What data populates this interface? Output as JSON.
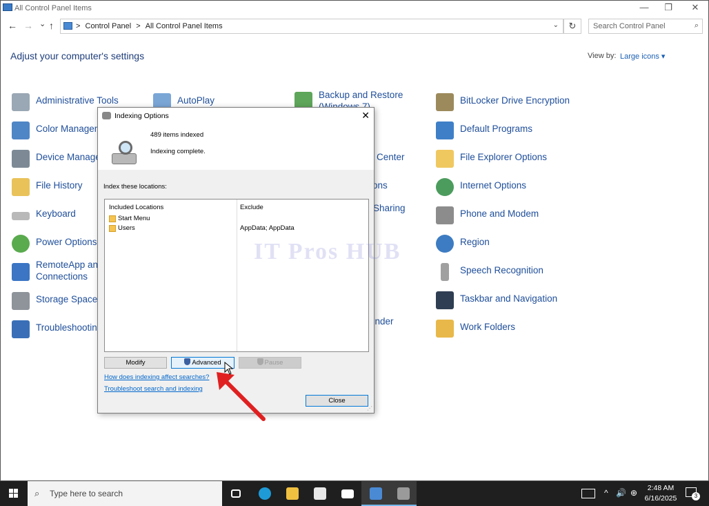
{
  "window": {
    "title": "All Control Panel Items",
    "minimize": "—",
    "maximize": "❐",
    "close": "✕"
  },
  "address": {
    "back": "←",
    "forward": "→",
    "recent": "⌄",
    "up": "↑",
    "sep": ">",
    "crumb1": "Control Panel",
    "crumb2": "All Control Panel Items",
    "refresh": "↻",
    "search_placeholder": "Search Control Panel",
    "search_icon": "⌕"
  },
  "main": {
    "heading": "Adjust your computer's settings",
    "view_by_label": "View by:",
    "view_by_value": "Large icons ▾"
  },
  "items": {
    "admin_tools": "Administrative Tools",
    "color_mgmt": "Color Managem",
    "device_mgr": "Device Manager",
    "file_history": "File History",
    "keyboard": "Keyboard",
    "power": "Power Options",
    "remoteapp_1": "RemoteApp and",
    "remoteapp_2": "Connections",
    "storage": "Storage Spaces",
    "troubleshoot": "Troubleshooting",
    "autoplay": "AutoPlay",
    "backup_1": "Backup and Restore",
    "backup_2": "(Windows 7)",
    "center": "Center",
    "ons": "ons",
    "sharing": "Sharing",
    "ender": "ender",
    "bitlocker": "BitLocker Drive Encryption",
    "default_programs": "Default Programs",
    "file_explorer": "File Explorer Options",
    "internet": "Internet Options",
    "phone_modem": "Phone and Modem",
    "region": "Region",
    "speech": "Speech Recognition",
    "taskbar_nav": "Taskbar and Navigation",
    "work_folders": "Work Folders"
  },
  "dialog": {
    "title": "Indexing Options",
    "close": "✕",
    "items_indexed": "489 items indexed",
    "status": "Indexing complete.",
    "index_label": "Index these locations:",
    "col_included": "Included Locations",
    "col_exclude": "Exclude",
    "locations": [
      "Start Menu",
      "Users"
    ],
    "exclude_users": "AppData; AppData",
    "modify": "Modify",
    "advanced": "Advanced",
    "pause": "Pause",
    "link_how": "How does indexing affect searches?",
    "link_troubleshoot": "Troubleshoot search and indexing",
    "close_button": "Close"
  },
  "watermark": "IT Pros HUB",
  "taskbar": {
    "search_placeholder": "Type here to search",
    "search_icon": "⌕",
    "tray_chevron": "^",
    "volume": "🔊",
    "network": "⊕",
    "time": "2:48 AM",
    "date": "6/16/2025",
    "notif_count": "3"
  }
}
